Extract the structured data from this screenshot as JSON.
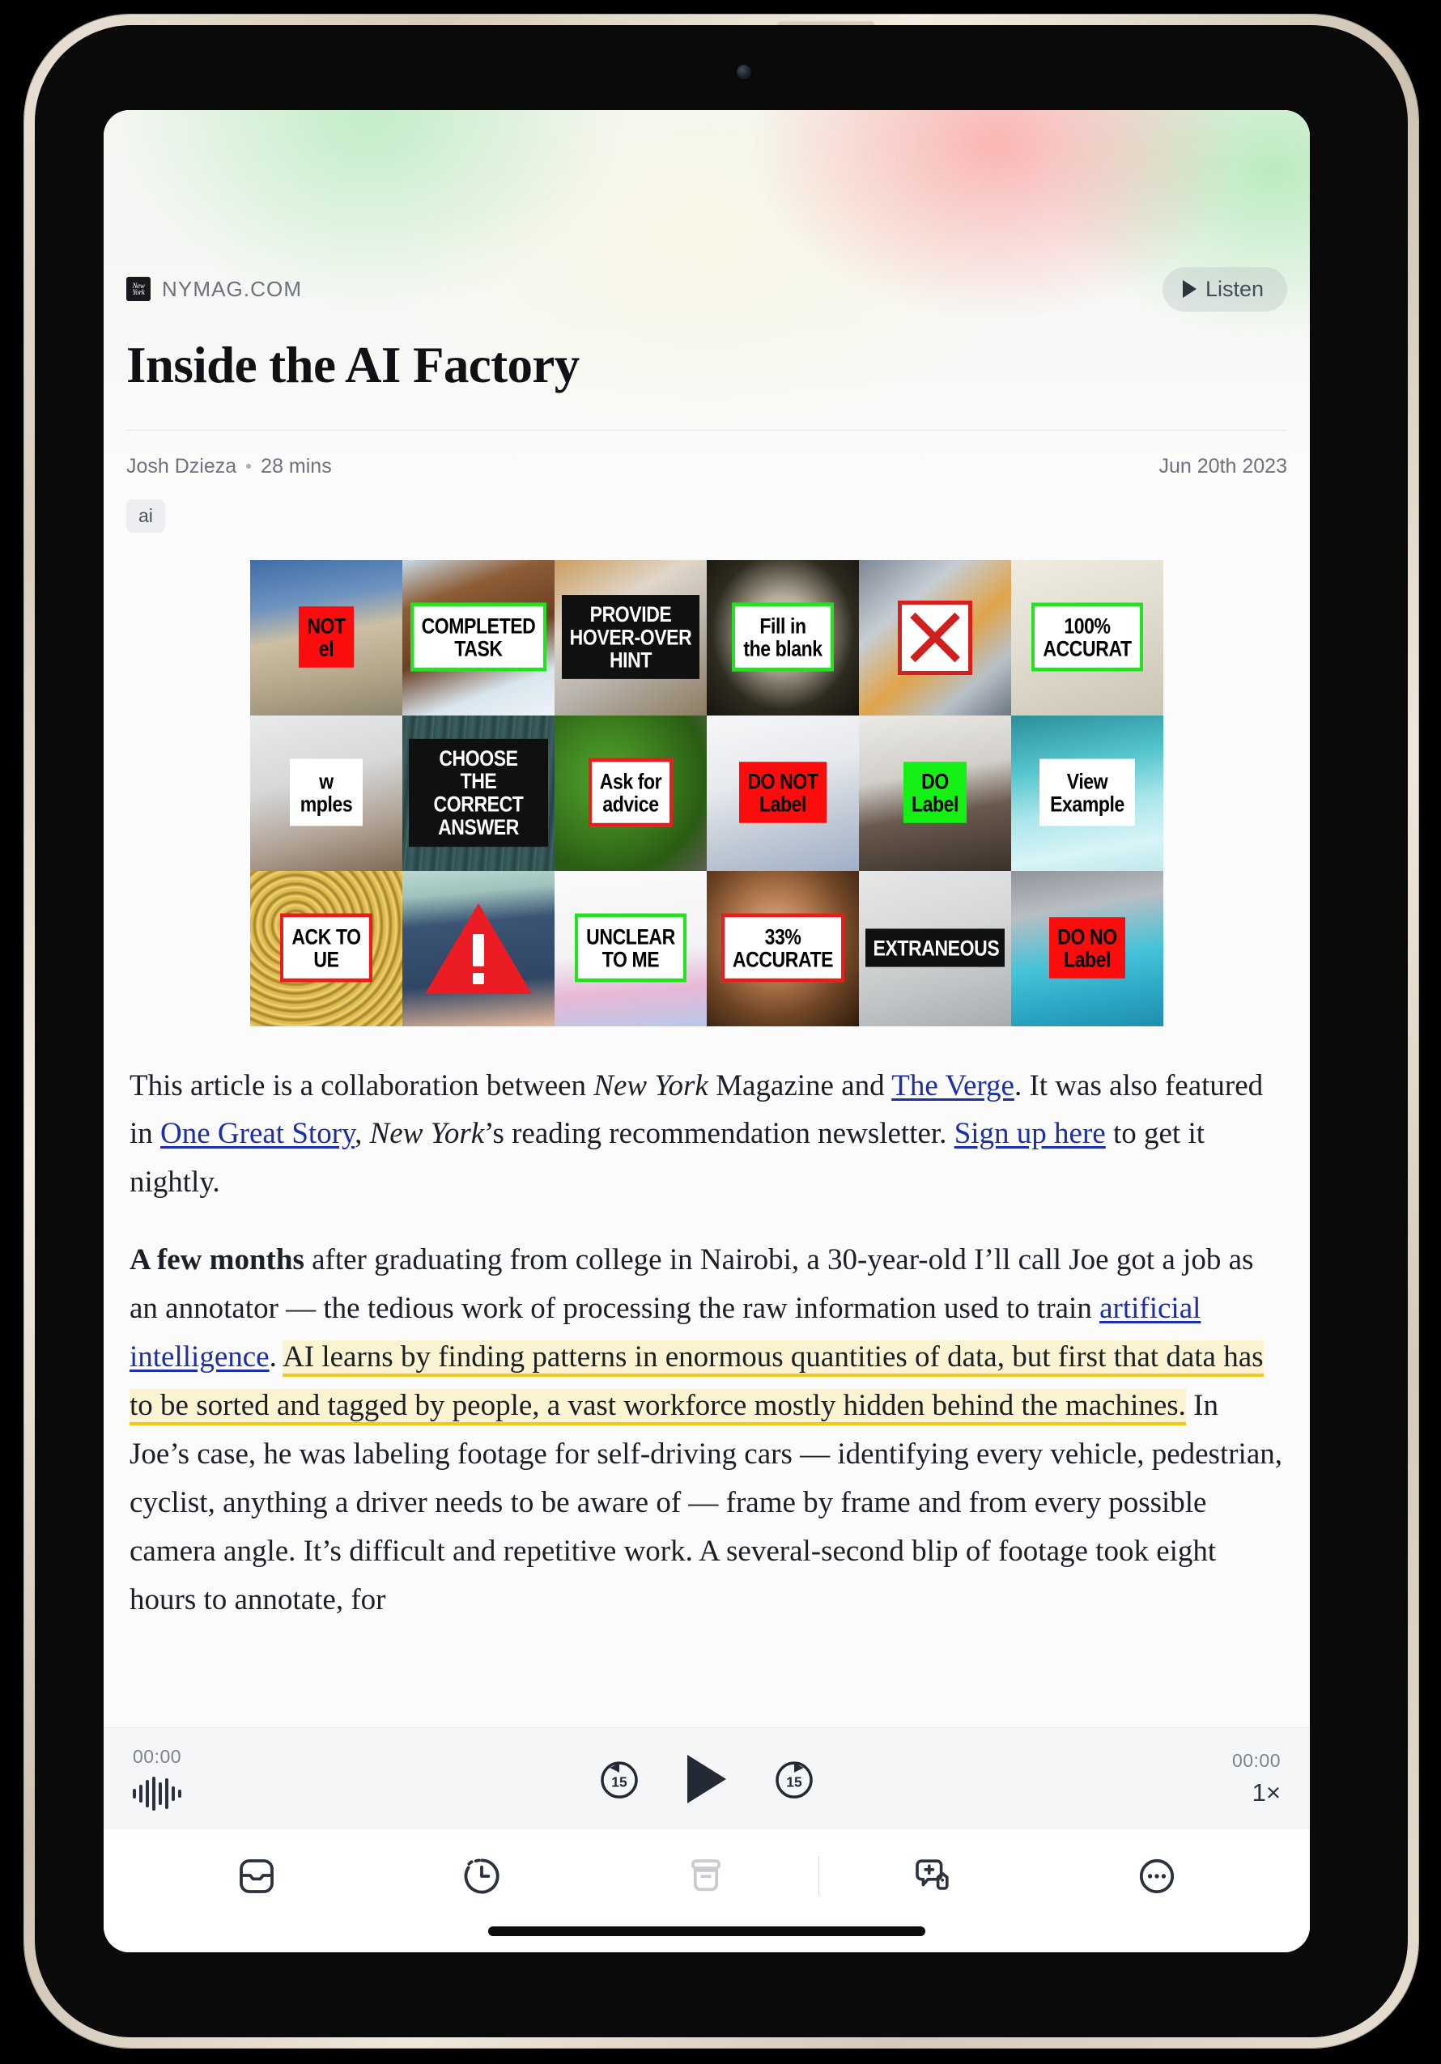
{
  "device": {
    "frame": "ipad",
    "body_color": "#e3d9cb"
  },
  "article": {
    "source_name": "NYMAG.COM",
    "favicon_text": "New York",
    "listen_button_label": "Listen",
    "title": "Inside the AI Factory",
    "author": "Josh Dzieza",
    "read_time": "28 mins",
    "date": "Jun 20th 2023",
    "tags": [
      "ai"
    ],
    "link_color": "#1c2ea8",
    "highlight_color": "#fcf3d2",
    "highlight_underline_color": "#f3c916"
  },
  "collage": {
    "columns": 6,
    "rows": 3,
    "cells": [
      {
        "label": "NOT\nel",
        "style": "fill-red",
        "scene": "acropolis-ruins"
      },
      {
        "label": "COMPLETED\nTASK",
        "style": "w-green",
        "scene": "horse-in-snow"
      },
      {
        "label": "PROVIDE\nHOVER-OVER\nHINT",
        "style": "fill-black",
        "scene": "packing-box"
      },
      {
        "label": "Fill in\nthe blank",
        "style": "w-green",
        "scene": "brain-scan"
      },
      {
        "label": "",
        "style": "x-mark",
        "scene": "woman-by-sportscar"
      },
      {
        "label": "100%\nACCURAT",
        "style": "w-green",
        "scene": "wall-switch"
      },
      {
        "label": "w\nmples",
        "style": "plain-white",
        "scene": "airplane-cabin"
      },
      {
        "label": "CHOOSE\nTHE CORRECT\nANSWER",
        "style": "fill-black",
        "scene": "metal-door"
      },
      {
        "label": "Ask for\nadvice",
        "style": "w-red",
        "scene": "green-leaves"
      },
      {
        "label": "DO NOT\nLabel",
        "style": "fill-red",
        "scene": "folded-laundry"
      },
      {
        "label": "DO\nLabel",
        "style": "fill-green",
        "scene": "clothing-rack"
      },
      {
        "label": "View\nExample",
        "style": "plain-white",
        "scene": "office-interior"
      },
      {
        "label": "ACK TO\nUE",
        "style": "w-red",
        "scene": "gold-glitter"
      },
      {
        "label": "",
        "style": "warn-tri",
        "scene": "man-in-shorts"
      },
      {
        "label": "UNCLEAR\nTO ME",
        "style": "w-green",
        "scene": "doll-in-gown"
      },
      {
        "label": "33%\nACCURATE",
        "style": "w-red",
        "scene": "classical-painting"
      },
      {
        "label": "EXTRANEOUS",
        "style": "fill-black",
        "scene": "toilet-stall"
      },
      {
        "label": "DO NO\nLabel",
        "style": "fill-red",
        "scene": "swimming-pool"
      }
    ]
  },
  "body": {
    "paragraphs": [
      {
        "id": "p1",
        "runs": [
          {
            "t": "This article is a collaboration between ",
            "k": "text"
          },
          {
            "t": "New York",
            "k": "em"
          },
          {
            "t": " Magazine and ",
            "k": "text"
          },
          {
            "t": "The Verge",
            "k": "link"
          },
          {
            "t": ". It was also featured in ",
            "k": "text"
          },
          {
            "t": "One Great Story",
            "k": "link"
          },
          {
            "t": ", ",
            "k": "text"
          },
          {
            "t": "New York",
            "k": "em"
          },
          {
            "t": "’s reading recommendation newsletter. ",
            "k": "text"
          },
          {
            "t": "Sign up here",
            "k": "link"
          },
          {
            "t": " to get it nightly.",
            "k": "text"
          }
        ]
      },
      {
        "id": "p2",
        "runs": [
          {
            "t": "A few months",
            "k": "strong"
          },
          {
            "t": " after graduating from college in Nairobi, a 30-year-old I’ll call Joe got a job as an annotator — the tedious work of processing the raw information used to train ",
            "k": "text"
          },
          {
            "t": "artificial intelligence",
            "k": "link"
          },
          {
            "t": ". ",
            "k": "text"
          },
          {
            "t": "AI learns by finding patterns in enormous quantities of data, but first that data has to be sorted and tagged by people, a vast workforce mostly hidden behind the machines.",
            "k": "highlight"
          },
          {
            "t": " In Joe’s case, he was labeling footage for self-driving cars — identifying every vehicle, pedestrian, cyclist, anything a driver needs to be aware of — frame by frame and from every possible camera angle. It’s difficult and repetitive work. A several-second blip of footage took eight hours to annotate, for",
            "k": "text"
          }
        ]
      }
    ]
  },
  "player": {
    "elapsed": "00:00",
    "remaining": "00:00",
    "speed": "1×",
    "skip_back_seconds": "15",
    "skip_forward_seconds": "15",
    "state": "paused"
  },
  "toolbar": {
    "items": [
      {
        "icon": "inbox-icon",
        "state": "active"
      },
      {
        "icon": "history-icon",
        "state": "active"
      },
      {
        "icon": "archive-icon",
        "state": "disabled"
      },
      {
        "icon": "separator",
        "state": "divider"
      },
      {
        "icon": "add-note-icon",
        "state": "active"
      },
      {
        "icon": "more-icon",
        "state": "active"
      }
    ]
  }
}
